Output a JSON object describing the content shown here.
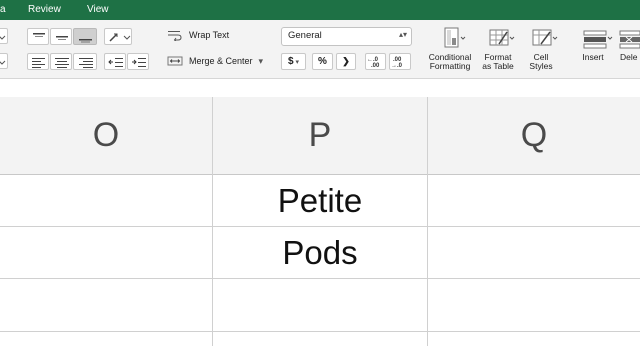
{
  "tabs": [
    {
      "id": "tab-a",
      "label": "a"
    },
    {
      "id": "tab-review",
      "label": "Review"
    },
    {
      "id": "tab-view",
      "label": "View"
    }
  ],
  "alignment": {
    "wrap_text_label": "Wrap Text",
    "merge_center_label": "Merge & Center",
    "merge_caret": "▾"
  },
  "number": {
    "format_value": "General",
    "currency": "$",
    "percent": "%",
    "comma": "❯",
    "increase_decimal": "←.0 .00",
    "decrease_decimal": ".00 →.0"
  },
  "styles": {
    "conditional_label_1": "Conditional",
    "conditional_label_2": "Formatting",
    "format_table_label_1": "Format",
    "format_table_label_2": "as Table",
    "cell_styles_label_1": "Cell",
    "cell_styles_label_2": "Styles"
  },
  "cells_group": {
    "insert_label": "Insert",
    "delete_label": "Dele"
  },
  "grid": {
    "columns": [
      "O",
      "P",
      "Q"
    ],
    "cells": {
      "P1": "Petite",
      "P2": "Pods"
    }
  },
  "colors": {
    "ribbon_green": "#1e7145",
    "ribbon_bg": "#f3f3f3",
    "header_bg": "#f3f3f3",
    "grid_line": "#d0d0d0"
  }
}
